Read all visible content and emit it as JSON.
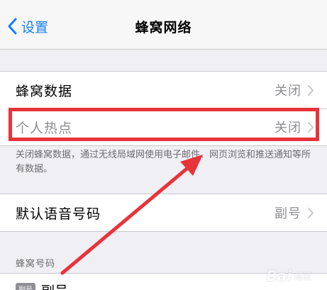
{
  "navbar": {
    "back_label": "设置",
    "title": "蜂窝网络"
  },
  "group1": {
    "rows": [
      {
        "label": "蜂窝数据",
        "value": "关闭"
      },
      {
        "label": "个人热点",
        "value": "关闭"
      }
    ],
    "footnote": "关闭蜂窝数据，通过无线局域网使用电子邮件、网页浏览和推送通知等所有数据。"
  },
  "group2": {
    "rows": [
      {
        "label": "默认语音号码",
        "value": "副号"
      }
    ]
  },
  "section": {
    "header": "蜂窝号码"
  },
  "sim": {
    "badge": "副号",
    "label": "副号"
  },
  "watermark": {
    "text": "Bai",
    "sub": "经验"
  },
  "colors": {
    "accent": "#157efb",
    "highlight": "#e8333b",
    "secondary_text": "#8e8e93"
  }
}
